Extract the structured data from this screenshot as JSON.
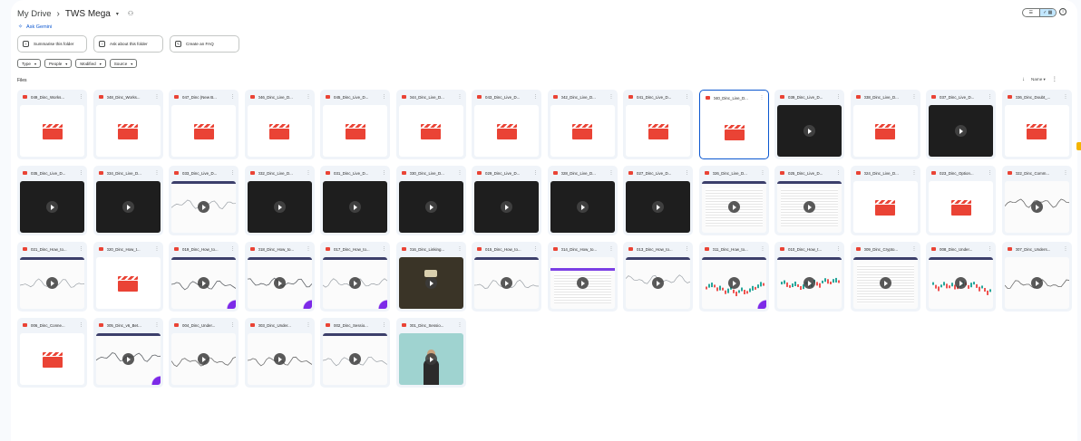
{
  "breadcrumb": {
    "root": "My Drive",
    "separator": "›",
    "current": "TWS Mega"
  },
  "header_icons": {
    "dropdown": "chevron-down-icon",
    "share": "people-icon",
    "list_view": "list-icon",
    "grid_view": "grid-icon",
    "info": "info-icon"
  },
  "gemini": {
    "label": "Ask Gemini"
  },
  "actions": [
    {
      "label": "Summarise this folder",
      "icon": "summary-icon"
    },
    {
      "label": "Ask about this folder",
      "icon": "question-icon"
    },
    {
      "label": "Create an FAQ",
      "icon": "faq-icon"
    }
  ],
  "filters": [
    {
      "label": "Type"
    },
    {
      "label": "People"
    },
    {
      "label": "Modified"
    },
    {
      "label": "Source"
    }
  ],
  "files_label": "Files",
  "sort": {
    "label": "Name"
  },
  "colors": {
    "accent": "#0b57d0",
    "video_red": "#ea4335",
    "card_bg": "#f0f4f9",
    "selected_bg": "#c2e7ff"
  },
  "files": [
    {
      "name": "049_Dinc_Works...",
      "thumb": "placeholder"
    },
    {
      "name": "048_Dinc_Works...",
      "thumb": "placeholder"
    },
    {
      "name": "047_Dinc (New B...",
      "thumb": "placeholder"
    },
    {
      "name": "046_Dinc_Live_D...",
      "thumb": "placeholder"
    },
    {
      "name": "045_Dinc_Live_D...",
      "thumb": "placeholder"
    },
    {
      "name": "044_Dinc_Live_D...",
      "thumb": "placeholder"
    },
    {
      "name": "043_Dinc_Live_D...",
      "thumb": "placeholder"
    },
    {
      "name": "042_Dinc_Live_D...",
      "thumb": "placeholder"
    },
    {
      "name": "041_Dinc_Live_D...",
      "thumb": "placeholder"
    },
    {
      "name": "040_Dinc_Live_D...",
      "thumb": "placeholder",
      "selected": true
    },
    {
      "name": "039_Dinc_Live_D...",
      "thumb": "dark"
    },
    {
      "name": "038_Dinc_Live_D...",
      "thumb": "placeholder"
    },
    {
      "name": "037_Dinc_Live_D...",
      "thumb": "dark"
    },
    {
      "name": "036_Dinc_Doubt_...",
      "thumb": "placeholder"
    },
    {
      "name": "035_Dinc_Live_D...",
      "thumb": "dark"
    },
    {
      "name": "034_Dinc_Live_D...",
      "thumb": "dark"
    },
    {
      "name": "033_Dinc_Live_D...",
      "thumb": "chart"
    },
    {
      "name": "032_Dinc_Live_D...",
      "thumb": "dark"
    },
    {
      "name": "031_Dinc_Live_D...",
      "thumb": "dark"
    },
    {
      "name": "030_Dinc_Live_D...",
      "thumb": "dark"
    },
    {
      "name": "029_Dinc_Live_D...",
      "thumb": "dark"
    },
    {
      "name": "028_Dinc_Live_D...",
      "thumb": "dark"
    },
    {
      "name": "027_Dinc_Live_D...",
      "thumb": "dark"
    },
    {
      "name": "026_Dinc_Live_D...",
      "thumb": "table"
    },
    {
      "name": "025_Dinc_Live_D...",
      "thumb": "table"
    },
    {
      "name": "024_Dinc_Live_D...",
      "thumb": "placeholder"
    },
    {
      "name": "023_Dinc_Option...",
      "thumb": "placeholder"
    },
    {
      "name": "022_Dinc_Comm...",
      "thumb": "line"
    },
    {
      "name": "021_Dinc_How_to...",
      "thumb": "chart"
    },
    {
      "name": "020_Dinc_How_t...",
      "thumb": "placeholder"
    },
    {
      "name": "019_Dinc_How_to...",
      "thumb": "line-purple"
    },
    {
      "name": "018_Dinc_How_to...",
      "thumb": "line-purple"
    },
    {
      "name": "017_Dinc_How_to...",
      "thumb": "chart-purple"
    },
    {
      "name": "016_Dinc_Linking...",
      "thumb": "brown"
    },
    {
      "name": "015_Dinc_How_to...",
      "thumb": "chart"
    },
    {
      "name": "014_Dinc_How_to...",
      "thumb": "purplebar"
    },
    {
      "name": "013_Dinc_How_to...",
      "thumb": "chart"
    },
    {
      "name": "011_Dinc_How_to...",
      "thumb": "candles-purple"
    },
    {
      "name": "010_Dinc_How_t...",
      "thumb": "candles"
    },
    {
      "name": "009_Dinc_Crypto...",
      "thumb": "table"
    },
    {
      "name": "008_Dinc_Under...",
      "thumb": "candles"
    },
    {
      "name": "007_Dinc_Unders...",
      "thumb": "line"
    },
    {
      "name": "006_Dinc_Conne...",
      "thumb": "placeholder"
    },
    {
      "name": "005_Dinc_v6_Bet...",
      "thumb": "line-purple"
    },
    {
      "name": "004_Dinc_Under...",
      "thumb": "line"
    },
    {
      "name": "003_Dinc_Under...",
      "thumb": "line"
    },
    {
      "name": "002_Dinc_Sessio...",
      "thumb": "chart"
    },
    {
      "name": "001_Dinc_Sessio...",
      "thumb": "cam"
    }
  ]
}
